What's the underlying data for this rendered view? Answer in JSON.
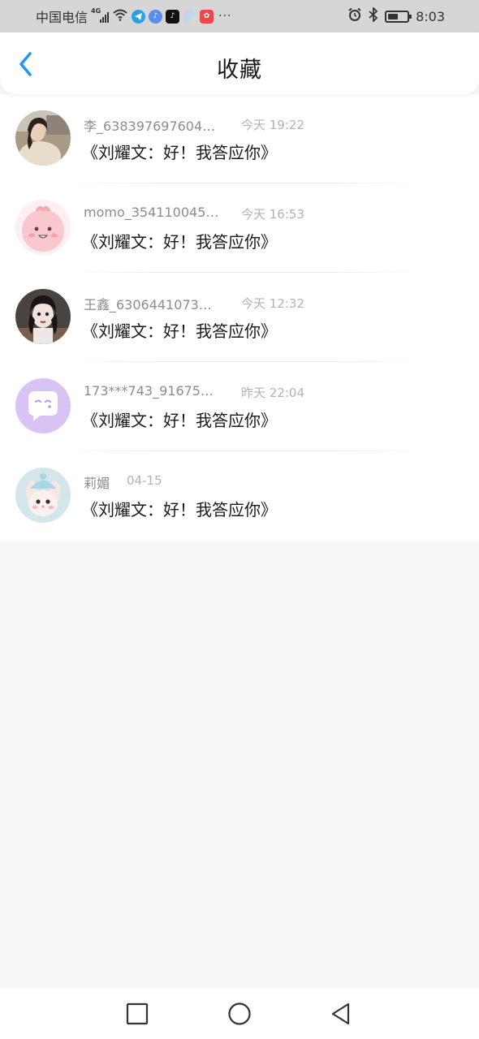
{
  "status_bar": {
    "carrier": "中国电信",
    "signal_label": "4G",
    "time": "8:03",
    "battery_level": 0.55,
    "more": "···",
    "app_icons": [
      "telegram-icon",
      "music-icon",
      "douyin-icon",
      "photos-icon",
      "huawei-icon"
    ]
  },
  "header": {
    "title": "收藏",
    "accent_color": "#2196f3"
  },
  "favorites": [
    {
      "name": "李_638397697604…",
      "time": "今天 19:22",
      "message": "《刘耀文：好！我答应你》",
      "avatar": "photo-girl-avatar"
    },
    {
      "name": "momo_354110045…",
      "time": "今天 16:53",
      "message": "《刘耀文：好！我答应你》",
      "avatar": "pink-cartoon-avatar"
    },
    {
      "name": "王鑫_6306441073…",
      "time": "今天 12:32",
      "message": "《刘耀文：好！我答应你》",
      "avatar": "dark-portrait-avatar"
    },
    {
      "name": "173***743_91675…",
      "time": "昨天 22:04",
      "message": "《刘耀文：好！我答应你》",
      "avatar": "purple-chat-avatar"
    },
    {
      "name": "莉媚",
      "time": "04-15",
      "message": "《刘耀文：好！我答应你》",
      "avatar": "bunny-avatar"
    }
  ]
}
